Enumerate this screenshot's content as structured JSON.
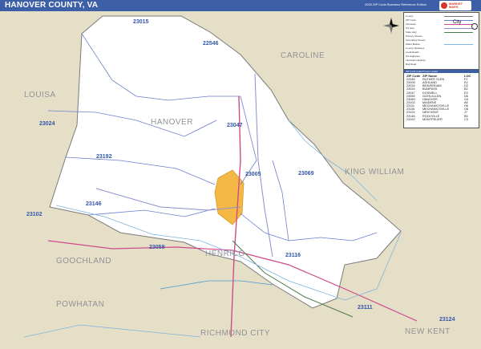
{
  "title": "HANOVER COUNTY, VA",
  "edition": "2020 ZIP Code Business Reference Edition",
  "brand": {
    "line1": "MARKET",
    "line2": "MAPS"
  },
  "map": {
    "counties": [
      "HANOVER",
      "CAROLINE",
      "LOUISA",
      "KING WILLIAM",
      "GOOCHLAND",
      "HENRICO",
      "POWHATAN",
      "RICHMOND CITY",
      "NEW KENT"
    ],
    "zips": [
      "23015",
      "22546",
      "23024",
      "23047",
      "23192",
      "23005",
      "23069",
      "23146",
      "23102",
      "23059",
      "23116",
      "23111",
      "23124"
    ]
  },
  "legend": {
    "items": [
      "County",
      "ZIP Code",
      "Interstate",
      "US Hwy",
      "State Hwy",
      "Primary Streets",
      "Secondary Streets",
      "Water Bodies",
      "County Highways",
      "Local Roads",
      "US Highways",
      "Interstate Highway",
      "Rail Road"
    ],
    "city_label": "City"
  },
  "zip_table": {
    "title": "ZIP Code Index/Cross Locator",
    "columns": [
      "ZIP Code",
      "ZIP Name",
      "LOC"
    ],
    "rows": [
      [
        "22546",
        "RUTHER GLEN",
        "F2"
      ],
      [
        "23005",
        "ASHLAND",
        "E4"
      ],
      [
        "23015",
        "BEAVERDAM",
        "D2"
      ],
      [
        "23024",
        "BUMPASS",
        "B2"
      ],
      [
        "23047",
        "DOSWELL",
        "E3"
      ],
      [
        "23059",
        "GLEN ALLEN",
        "D6"
      ],
      [
        "23069",
        "HANOVER",
        "G4"
      ],
      [
        "23102",
        "MAIDENS",
        "A6"
      ],
      [
        "23111",
        "MECHANICSVILLE",
        "H6"
      ],
      [
        "23116",
        "MECHANICSVILLE",
        "G6"
      ],
      [
        "23124",
        "NEW KENT",
        "J7"
      ],
      [
        "23146",
        "ROCKVILLE",
        "B5"
      ],
      [
        "23192",
        "MONTPELIER",
        "C3"
      ]
    ]
  }
}
